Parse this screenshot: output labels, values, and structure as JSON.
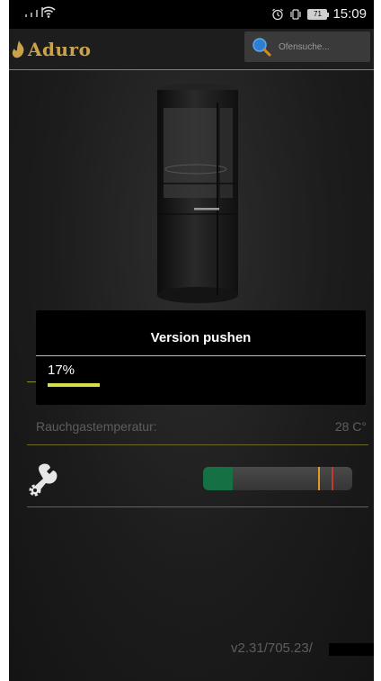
{
  "status_bar": {
    "time": "15:09",
    "battery": "71",
    "icons": [
      "signal-icon",
      "wifi-icon",
      "alarm-icon",
      "vibrate-icon",
      "battery-icon"
    ]
  },
  "header": {
    "logo_text": "Aduro",
    "search_placeholder": "Ofensuche...",
    "divider_color": "#8c8a2c"
  },
  "dialog": {
    "title": "Version pushen",
    "progress_text": "17%",
    "progress": 0.17,
    "progress_color": "#d7dd4c"
  },
  "details": {
    "flue_temp_label": "Rauchgastemperatur:",
    "flue_temp_value": "28 C°"
  },
  "tools": {
    "icon": "wrench-gear-icon",
    "gauge": {
      "green_fraction": 0.2,
      "orange_marker": 0.77,
      "red_marker": 0.86,
      "colors": {
        "green": "#157043",
        "orange": "#e29a22",
        "red": "#c43b2d"
      }
    }
  },
  "footer": {
    "version": "v2.31/705.23/"
  }
}
